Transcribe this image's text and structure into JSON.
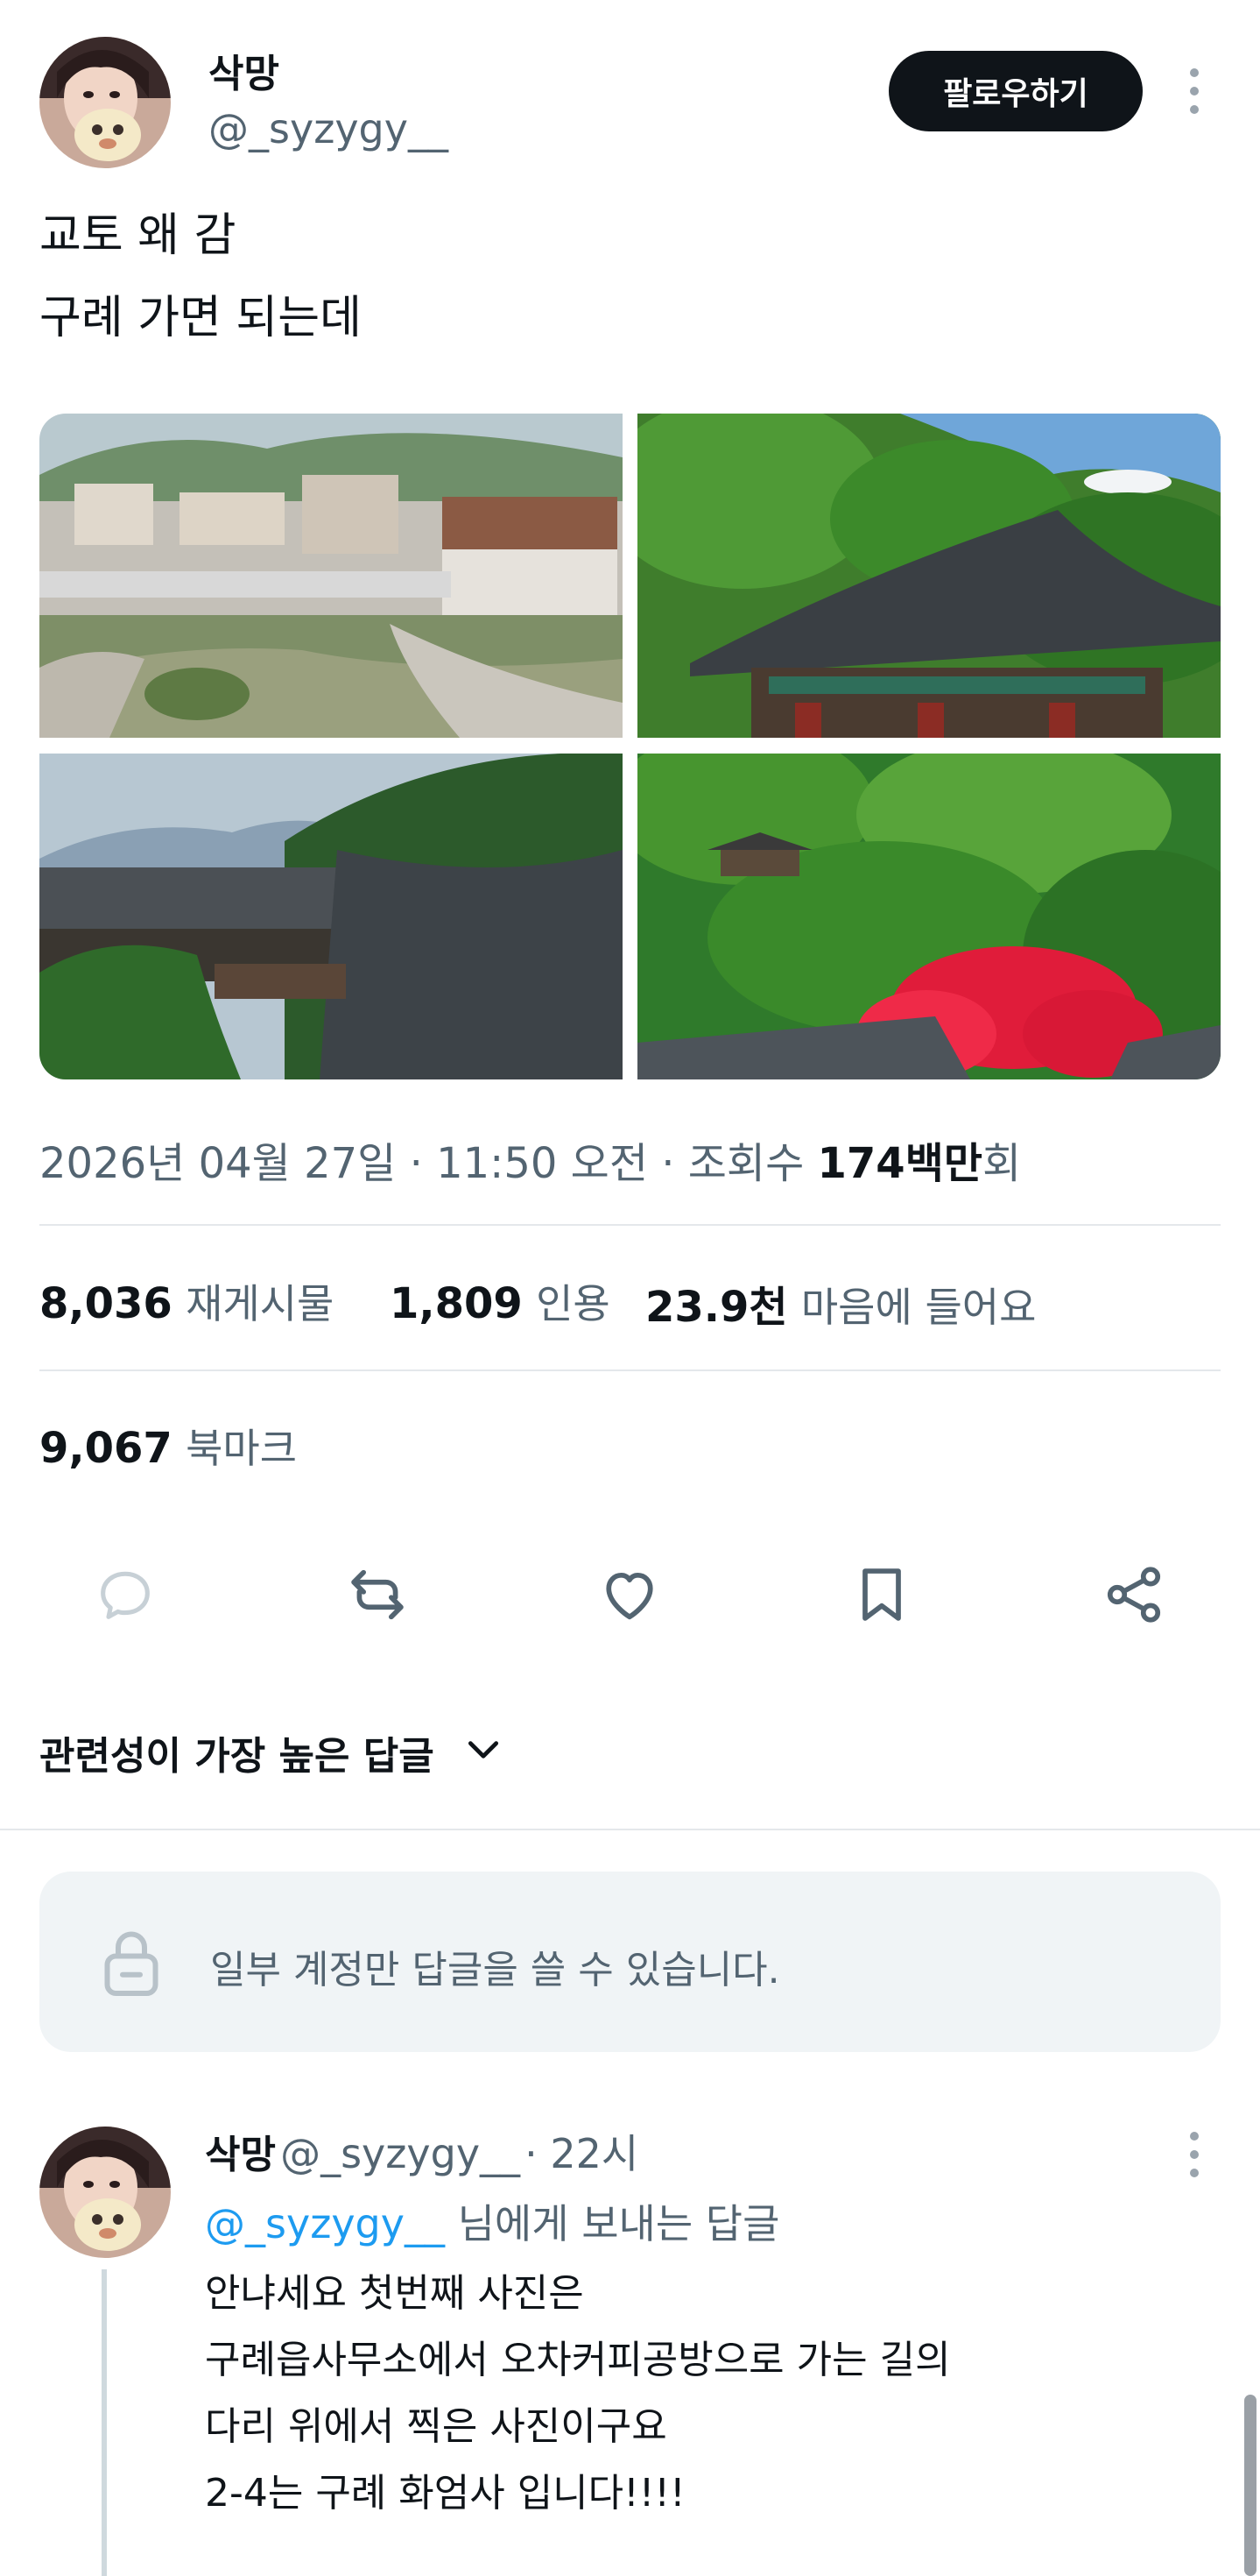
{
  "tweet": {
    "display_name": "삭망",
    "handle": "@_syzygy__",
    "follow_label": "팔로우하기",
    "text_lines": [
      "교토 왜 감",
      "구례 가면 되는데"
    ],
    "timestamp": "2026년 04월 27일 · 11:50 오전 · 조회수 ",
    "views_value": "174백만",
    "views_suffix": "회"
  },
  "stats": {
    "retweets": {
      "value": "8,036",
      "label": "재게시물"
    },
    "quotes": {
      "value": "1,809",
      "label": "인용"
    },
    "likes": {
      "value": "23.9천",
      "label": "마음에 들어요"
    },
    "bookmarks": {
      "value": "9,067",
      "label": "북마크"
    }
  },
  "actions": [
    {
      "name": "reply",
      "icon": "reply-icon"
    },
    {
      "name": "retweet",
      "icon": "retweet-icon"
    },
    {
      "name": "like",
      "icon": "heart-icon"
    },
    {
      "name": "bookmark",
      "icon": "bookmark-icon"
    },
    {
      "name": "share",
      "icon": "share-icon"
    }
  ],
  "replies_sort": {
    "label": "관련성이 가장 높은 답글"
  },
  "notice": {
    "text": "일부 계정만 답글을 쓸 수 있습니다."
  },
  "reply": {
    "display_name": "삭망",
    "handle": "@_syzygy__",
    "time": "· 22시",
    "reply_to_link": "@_syzygy__",
    "reply_to_suffix": " 님에게 보내는 답글",
    "body_lines": [
      "안냐세요 첫번째 사진은",
      "구례읍사무소에서 오차커피공방으로 가는 길의",
      "다리 위에서 찍은 사진이구요",
      "2-4는 구례 화엄사 입니다!!!!"
    ]
  },
  "colors": {
    "text": "#0f1419",
    "secondary": "#536471",
    "link": "#1d9bf0",
    "follow_bg": "#0f1419",
    "notice_bg": "#f0f4f6",
    "divider": "#e4e8eb"
  }
}
